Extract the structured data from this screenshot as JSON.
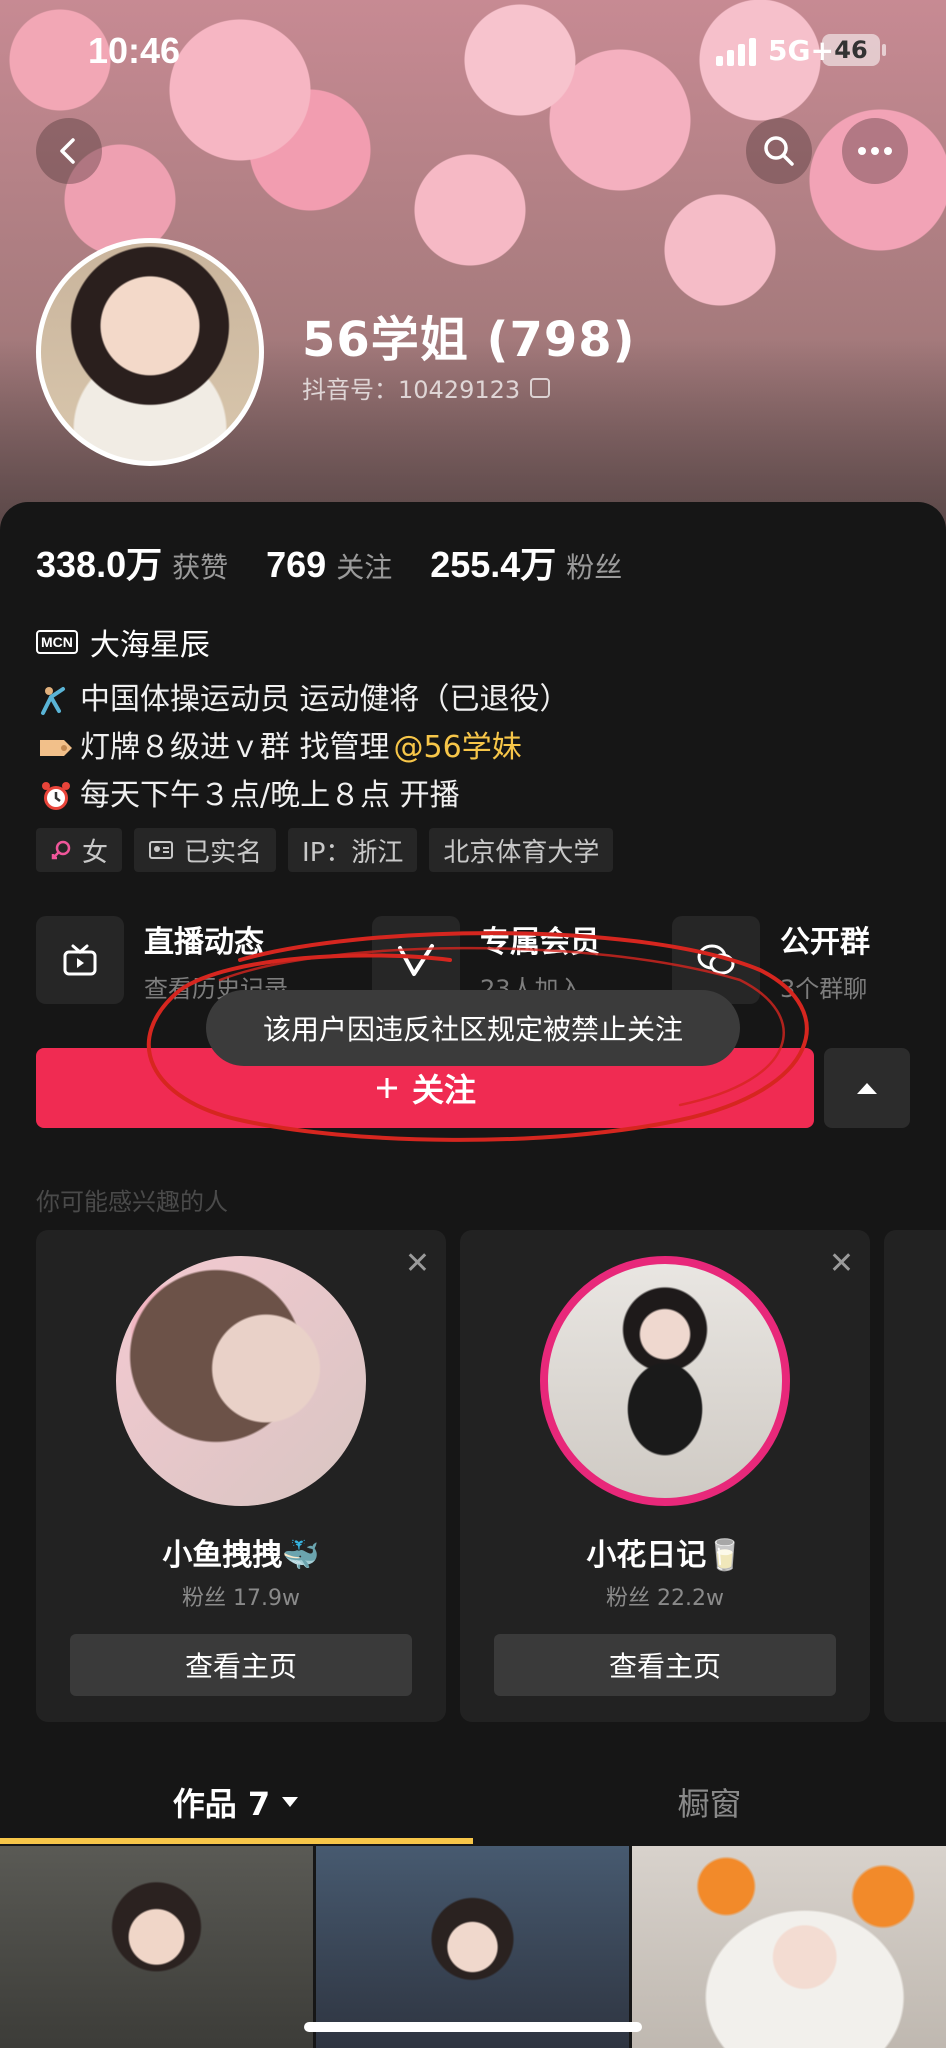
{
  "status_bar": {
    "time": "10:46",
    "network": "5G+",
    "battery": "46"
  },
  "profile": {
    "name": "56学姐 (798)",
    "douyin_id": "抖音号：10429123"
  },
  "stats": [
    {
      "value": "338.0万",
      "label": "获赞"
    },
    {
      "value": "769",
      "label": "关注"
    },
    {
      "value": "255.4万",
      "label": "粉丝"
    }
  ],
  "mcn": {
    "badge": "MCN",
    "name": "大海星辰"
  },
  "bio": {
    "line1": "中国体操运动员 运动健将（已退役）",
    "line2_prefix": "灯牌８级进ｖ群 找管理 ",
    "line2_mention": "@56学妹",
    "line3": "每天下午３点/晚上８点 开播"
  },
  "tags": [
    "女",
    "已实名",
    "IP：浙江",
    "北京体育大学"
  ],
  "features": [
    {
      "title": "直播动态",
      "sub": "查看历史记录"
    },
    {
      "title": "专属会员",
      "sub": "23人加入"
    },
    {
      "title": "公开群",
      "sub": "3个群聊"
    }
  ],
  "toast": "该用户因违反社区规定被禁止关注",
  "follow_button": "关注",
  "recommend": {
    "title": "你可能感兴趣的人",
    "cards": [
      {
        "name": "小鱼拽拽🐳",
        "fans": "粉丝 17.9w",
        "button": "查看主页"
      },
      {
        "name": "小花日记🥛",
        "fans": "粉丝 22.2w",
        "button": "查看主页"
      }
    ]
  },
  "tabs": {
    "works": "作品 7",
    "showcase": "橱窗"
  },
  "colors": {
    "accent_red": "#f02b52",
    "accent_yellow": "#f7c649",
    "background": "#161616"
  }
}
